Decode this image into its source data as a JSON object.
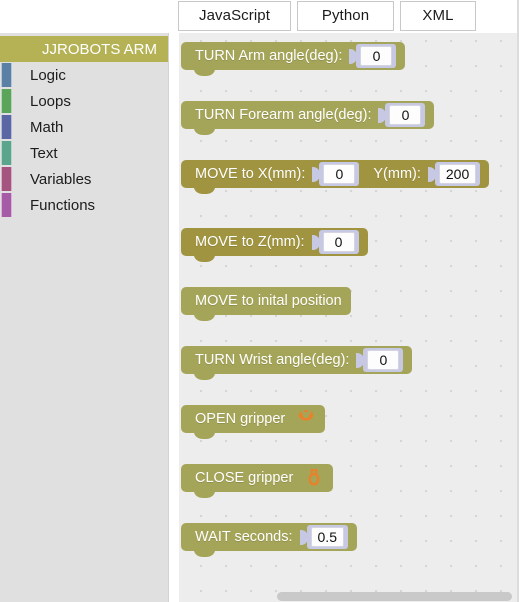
{
  "tabs": [
    {
      "id": "javascript",
      "label": "JavaScript"
    },
    {
      "id": "python",
      "label": "Python"
    },
    {
      "id": "xml",
      "label": "XML"
    }
  ],
  "toolbox": {
    "title": "blocks",
    "selected": "JJROBOTS ARM",
    "categories": [
      {
        "label": "JJROBOTS ARM",
        "color": "#b4b254",
        "selected": true
      },
      {
        "label": "Logic",
        "color": "#5b80a5",
        "selected": false
      },
      {
        "label": "Loops",
        "color": "#5ba55b",
        "selected": false
      },
      {
        "label": "Math",
        "color": "#5b67a5",
        "selected": false
      },
      {
        "label": "Text",
        "color": "#5ba58c",
        "selected": false
      },
      {
        "label": "Variables",
        "color": "#a5537f",
        "selected": false
      },
      {
        "label": "Functions",
        "color": "#a55ba5",
        "selected": false
      }
    ]
  },
  "flyout": {
    "block_color": "#a5a559",
    "block_color_dark": "#a09440",
    "field_frame_color": "#c7c9e4",
    "gripper_icon_color": "#e8822a",
    "blocks": [
      {
        "id": "turn-arm-angle",
        "label": "TURN Arm angle(deg):",
        "fields": [
          {
            "name": "angle",
            "value": "0"
          }
        ]
      },
      {
        "id": "turn-forearm-angle",
        "label": "TURN Forearm angle(deg):",
        "fields": [
          {
            "name": "angle",
            "value": "0"
          }
        ]
      },
      {
        "id": "move-to-xy",
        "label": "MOVE to X(mm):",
        "label2": "Y(mm):",
        "fields": [
          {
            "name": "x",
            "value": "0"
          },
          {
            "name": "y",
            "value": "200"
          }
        ]
      },
      {
        "id": "move-to-z",
        "label": "MOVE to Z(mm):",
        "fields": [
          {
            "name": "z",
            "value": "0"
          }
        ]
      },
      {
        "id": "move-to-initial-position",
        "label": "MOVE to inital position",
        "fields": []
      },
      {
        "id": "turn-wrist-angle",
        "label": "TURN Wrist angle(deg):",
        "fields": [
          {
            "name": "angle",
            "value": "0"
          }
        ]
      },
      {
        "id": "open-gripper",
        "label": "OPEN gripper",
        "icon": "gripper-open-icon",
        "fields": []
      },
      {
        "id": "close-gripper",
        "label": "CLOSE gripper",
        "icon": "gripper-closed-icon",
        "fields": []
      },
      {
        "id": "wait-seconds",
        "label": "WAIT seconds:",
        "fields": [
          {
            "name": "seconds",
            "value": "0.5"
          }
        ]
      }
    ]
  }
}
